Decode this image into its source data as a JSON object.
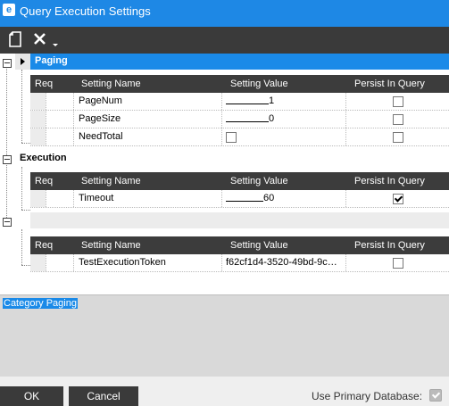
{
  "window": {
    "title": "Query Execution Settings",
    "app_icon": "e"
  },
  "toolbar": {
    "new_icon": "document-icon",
    "delete_icon": "close-icon"
  },
  "columns": {
    "req": "Req",
    "name": "Setting Name",
    "value": "Setting Value",
    "persist": "Persist In Query"
  },
  "categories": [
    {
      "title": "Paging",
      "rows": [
        {
          "name": "PageNum",
          "value": "1",
          "persist": false
        },
        {
          "name": "PageSize",
          "value": "0",
          "persist": false
        },
        {
          "name": "NeedTotal",
          "value_checkbox": false,
          "persist": false
        }
      ]
    },
    {
      "title": "Execution",
      "rows": [
        {
          "name": "Timeout",
          "value": "60",
          "persist": true
        }
      ]
    },
    {
      "title": "",
      "rows": [
        {
          "name": "TestExecutionToken",
          "value": "f62cf1d4-3520-49bd-9c…",
          "persist": false
        }
      ]
    }
  ],
  "description": {
    "text": "Category Paging"
  },
  "footer": {
    "ok_label": "OK",
    "cancel_label": "Cancel",
    "primary_db_label": "Use Primary Database:",
    "primary_db_checked": true
  },
  "colors": {
    "titlebar": "#1e88e5",
    "selection": "#1a8ae8",
    "header_dark": "#3c3c3c"
  }
}
